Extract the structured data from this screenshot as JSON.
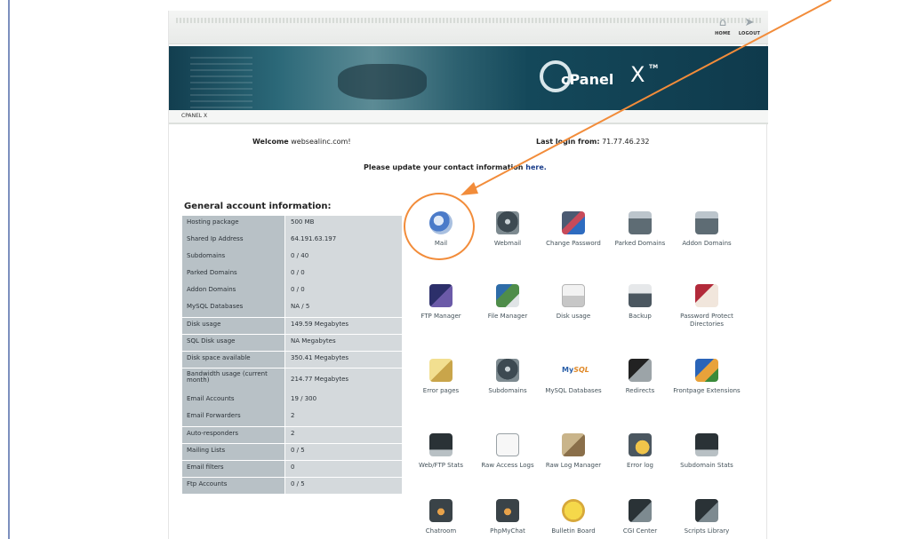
{
  "header": {
    "top_buttons": [
      {
        "id": "home",
        "label": "HOME"
      },
      {
        "id": "logout",
        "label": "LOGOUT"
      }
    ],
    "logo": {
      "brand": "cPanel",
      "version": "X"
    },
    "breadcrumb": "CPANEL X"
  },
  "welcome": {
    "prefix": "Welcome",
    "user": "websealinc.com!"
  },
  "last_login": {
    "prefix": "Last login from:",
    "ip": "71.77.46.232"
  },
  "notice": {
    "text": "Please update your contact information",
    "link": "here."
  },
  "account_info": {
    "title": "General account information:",
    "rows": [
      {
        "key": "Hosting package",
        "value": "500 MB"
      },
      {
        "key": "Shared Ip Address",
        "value": "64.191.63.197"
      },
      {
        "key": "Subdomains",
        "value": "0 / 40"
      },
      {
        "key": "Parked Domains",
        "value": "0 / 0"
      },
      {
        "key": "Addon Domains",
        "value": "0 / 0"
      },
      {
        "key": "MySQL Databases",
        "value": "NA / 5"
      },
      {
        "key": "Disk usage",
        "value": "149.59 Megabytes"
      },
      {
        "key": "SQL Disk usage",
        "value": "NA Megabytes"
      },
      {
        "key": "Disk space available",
        "value": "350.41 Megabytes"
      },
      {
        "key": "Bandwidth usage (current month)",
        "value": "214.77 Megabytes"
      },
      {
        "key": "Email Accounts",
        "value": "19 / 300"
      },
      {
        "key": "Email Forwarders",
        "value": "2"
      },
      {
        "key": "Auto-responders",
        "value": "2"
      },
      {
        "key": "Mailing Lists",
        "value": "0 / 5"
      },
      {
        "key": "Email filters",
        "value": "0"
      },
      {
        "key": "Ftp Accounts",
        "value": "0 / 5"
      }
    ]
  },
  "tools": [
    {
      "label": "Mail",
      "icon": "mail-icon"
    },
    {
      "label": "Webmail",
      "icon": "webmail-icon"
    },
    {
      "label": "Change Password",
      "icon": "lock-icon"
    },
    {
      "label": "Parked Domains",
      "icon": "parked-domains-icon"
    },
    {
      "label": "Addon Domains",
      "icon": "addon-domains-icon"
    },
    {
      "label": "FTP Manager",
      "icon": "ftp-icon"
    },
    {
      "label": "File Manager",
      "icon": "file-manager-icon"
    },
    {
      "label": "Disk usage",
      "icon": "disk-usage-icon"
    },
    {
      "label": "Backup",
      "icon": "backup-icon"
    },
    {
      "label": "Password Protect Directories",
      "icon": "password-protect-icon"
    },
    {
      "label": "Error pages",
      "icon": "error-pages-icon"
    },
    {
      "label": "Subdomains",
      "icon": "subdomains-icon"
    },
    {
      "label": "MySQL Databases",
      "icon": "mysql-icon"
    },
    {
      "label": "Redirects",
      "icon": "redirects-icon"
    },
    {
      "label": "Frontpage Extensions",
      "icon": "frontpage-icon"
    },
    {
      "label": "Web/FTP Stats",
      "icon": "stats-icon"
    },
    {
      "label": "Raw Access Logs",
      "icon": "raw-logs-icon"
    },
    {
      "label": "Raw Log Manager",
      "icon": "raw-log-manager-icon"
    },
    {
      "label": "Error log",
      "icon": "error-log-icon"
    },
    {
      "label": "Subdomain Stats",
      "icon": "subdomain-stats-icon"
    },
    {
      "label": "Chatroom",
      "icon": "chatroom-icon"
    },
    {
      "label": "PhpMyChat",
      "icon": "phpmychat-icon"
    },
    {
      "label": "Bulletin Board",
      "icon": "bulletin-board-icon"
    },
    {
      "label": "CGI Center",
      "icon": "cgi-center-icon"
    },
    {
      "label": "Scripts Library",
      "icon": "scripts-library-icon"
    }
  ],
  "annotation": {
    "color": "#f28c3a",
    "target": "Mail"
  },
  "mysql_logo": {
    "main": "My",
    "accent": "SQL"
  }
}
